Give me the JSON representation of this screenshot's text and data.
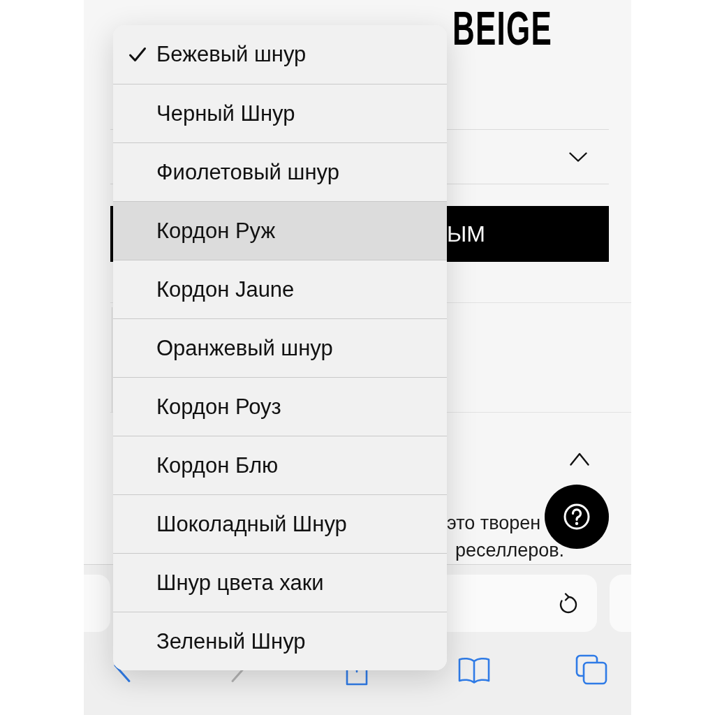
{
  "product_title": "BEIGE",
  "action_button": {
    "label": "ЫМ"
  },
  "accordion": {
    "expanded": true
  },
  "description_fragments": [
    "это творен",
    "реселлеров."
  ],
  "dropdown": {
    "options": [
      {
        "label": "Бежевый шнур",
        "selected": true,
        "highlighted": false
      },
      {
        "label": "Черный Шнур",
        "selected": false,
        "highlighted": false
      },
      {
        "label": "Фиолетовый шнур",
        "selected": false,
        "highlighted": false
      },
      {
        "label": "Кордон Руж",
        "selected": false,
        "highlighted": true
      },
      {
        "label": "Кордон Jaune",
        "selected": false,
        "highlighted": false
      },
      {
        "label": "Оранжевый шнур",
        "selected": false,
        "highlighted": false
      },
      {
        "label": "Кордон Роуз",
        "selected": false,
        "highlighted": false
      },
      {
        "label": "Кордон Блю",
        "selected": false,
        "highlighted": false
      },
      {
        "label": "Шоколадный Шнур",
        "selected": false,
        "highlighted": false
      },
      {
        "label": "Шнур цвета хаки",
        "selected": false,
        "highlighted": false
      },
      {
        "label": "Зеленый Шнур",
        "selected": false,
        "highlighted": false
      }
    ]
  },
  "browser_toolbar": {
    "buttons": [
      {
        "kind": "back",
        "disabled": false
      },
      {
        "kind": "forward",
        "disabled": true
      },
      {
        "kind": "share",
        "disabled": false
      },
      {
        "kind": "bookmarks",
        "disabled": false
      },
      {
        "kind": "tabs",
        "disabled": false
      }
    ]
  }
}
